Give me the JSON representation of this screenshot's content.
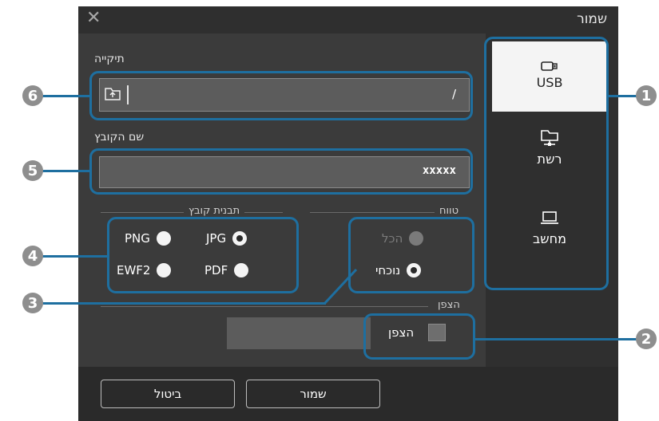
{
  "window": {
    "title": "שמור",
    "close_icon": "close-icon"
  },
  "sources": [
    {
      "label": "USB",
      "icon": "usb-drive-icon",
      "selected": true
    },
    {
      "label": "רשת",
      "icon": "network-folder-icon",
      "selected": false
    },
    {
      "label": "מחשב",
      "icon": "computer-icon",
      "selected": false
    }
  ],
  "folder": {
    "label": "תיקייה",
    "value": "/",
    "browse_icon": "folder-browse-icon"
  },
  "filename": {
    "label": "שם הקובץ",
    "value": "xxxxx"
  },
  "format": {
    "label": "תבנית קובץ",
    "options": [
      {
        "label": "PNG",
        "selected": false
      },
      {
        "label": "JPG",
        "selected": true
      },
      {
        "label": "EWF2",
        "selected": false
      },
      {
        "label": "PDF",
        "selected": false
      }
    ]
  },
  "range": {
    "label": "טווח",
    "options": [
      {
        "label": "הכל",
        "selected": false,
        "disabled": true
      },
      {
        "label": "נוכחי",
        "selected": true,
        "disabled": false
      }
    ]
  },
  "encrypt": {
    "section_label": "הצפן",
    "checkbox_label": "הצפן",
    "checked": false
  },
  "footer": {
    "save_label": "שמור",
    "cancel_label": "ביטול"
  },
  "callouts": [
    "1",
    "2",
    "3",
    "4",
    "5",
    "6"
  ],
  "colors": {
    "callout": "#1e6fa0",
    "panel": "#3b3b3b",
    "badge": "#8e8e8e"
  }
}
